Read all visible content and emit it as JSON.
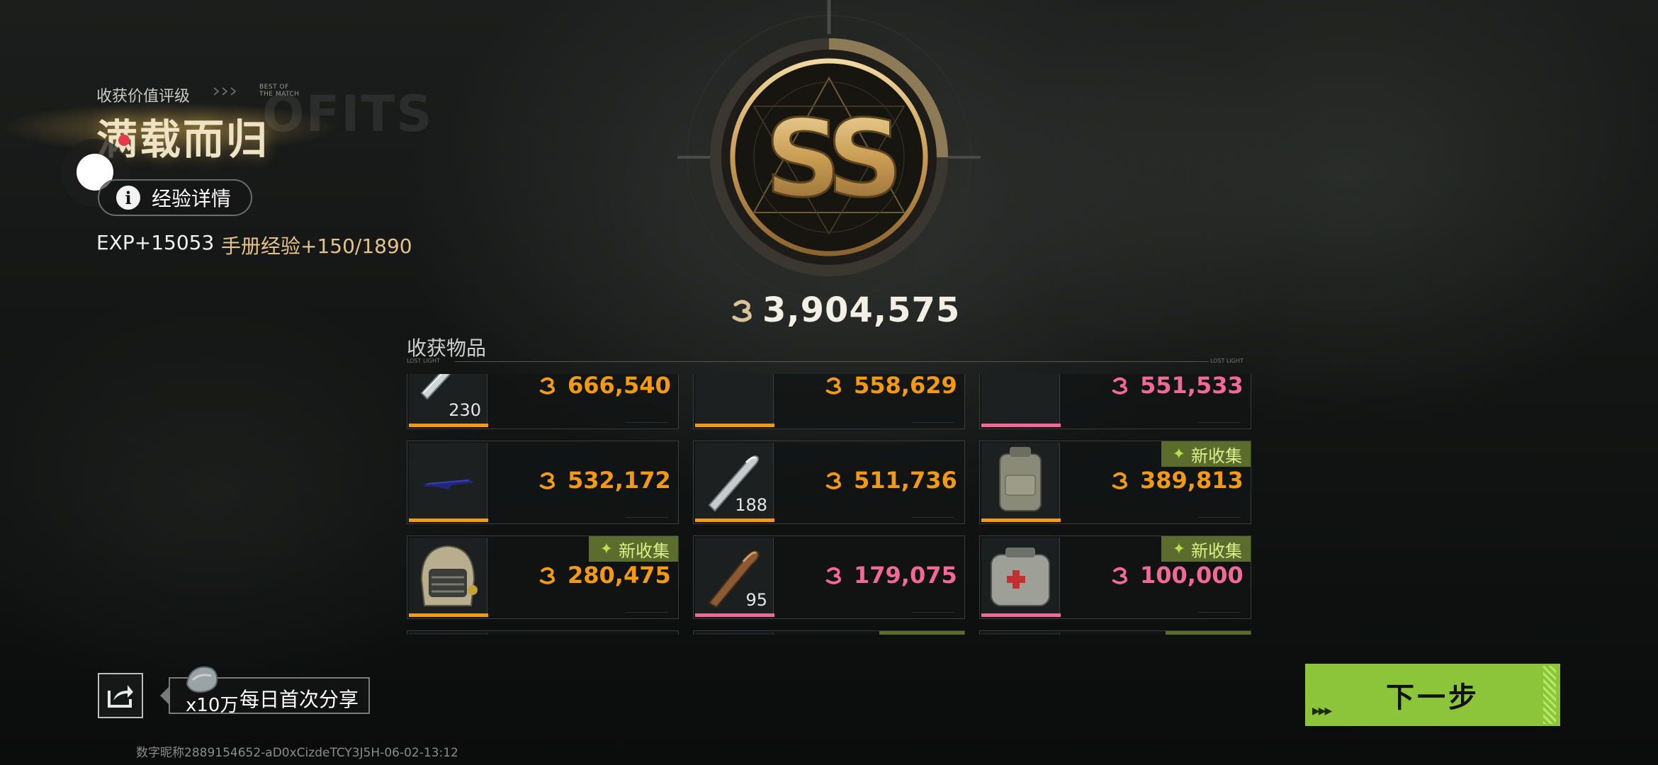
{
  "header": {
    "rating_label": "收获价值评级",
    "best_of_line1": "BEST OF",
    "best_of_line2": "THE MATCH",
    "rating_title": "满载而归",
    "bg_watermark": "OFITS",
    "exp_button": "经验详情",
    "exp_gain": "EXP+15053",
    "handbook_exp": "手册经验+150/1890"
  },
  "badge": {
    "grade": "SS",
    "total_value": "3,904,575"
  },
  "items_section": {
    "title": "收获物品",
    "lost_light_left": "LOST LIGHT",
    "lost_light_right": "LOST LIGHT",
    "items": [
      {
        "icon": "silver-tube-icon",
        "qty": "230",
        "price": "666,540",
        "rarity": "orange",
        "new_tag": ""
      },
      {
        "icon": "green-rifle-icon",
        "qty": "",
        "price": "558,629",
        "rarity": "orange",
        "new_tag": ""
      },
      {
        "icon": "sniper-rifle-icon",
        "qty": "",
        "price": "551,533",
        "rarity": "pink",
        "new_tag": ""
      },
      {
        "icon": "blue-rifle-icon",
        "qty": "",
        "price": "532,172",
        "rarity": "orange",
        "new_tag": ""
      },
      {
        "icon": "bullet-icon",
        "qty": "188",
        "price": "511,736",
        "rarity": "orange",
        "new_tag": ""
      },
      {
        "icon": "backpack-icon",
        "qty": "",
        "price": "389,813",
        "rarity": "orange",
        "new_tag": "新收集"
      },
      {
        "icon": "helmet-icon",
        "qty": "",
        "price": "280,475",
        "rarity": "orange",
        "new_tag": "新收集"
      },
      {
        "icon": "copper-bullet-icon",
        "qty": "95",
        "price": "179,075",
        "rarity": "pink",
        "new_tag": ""
      },
      {
        "icon": "medical-bag-icon",
        "qty": "",
        "price": "100,000",
        "rarity": "pink",
        "new_tag": "新收集"
      }
    ]
  },
  "share": {
    "reward_qty": "x10万",
    "label": "每日首次分享"
  },
  "watermark": "数字昵称2889154652-aD0xCizdeTCY3J5H-06-02-13:12",
  "next_button": "下一步",
  "colors": {
    "orange": "#f29a14",
    "pink": "#f06a95",
    "accent_green": "#8cc43a",
    "gold": "#c8a05a"
  }
}
